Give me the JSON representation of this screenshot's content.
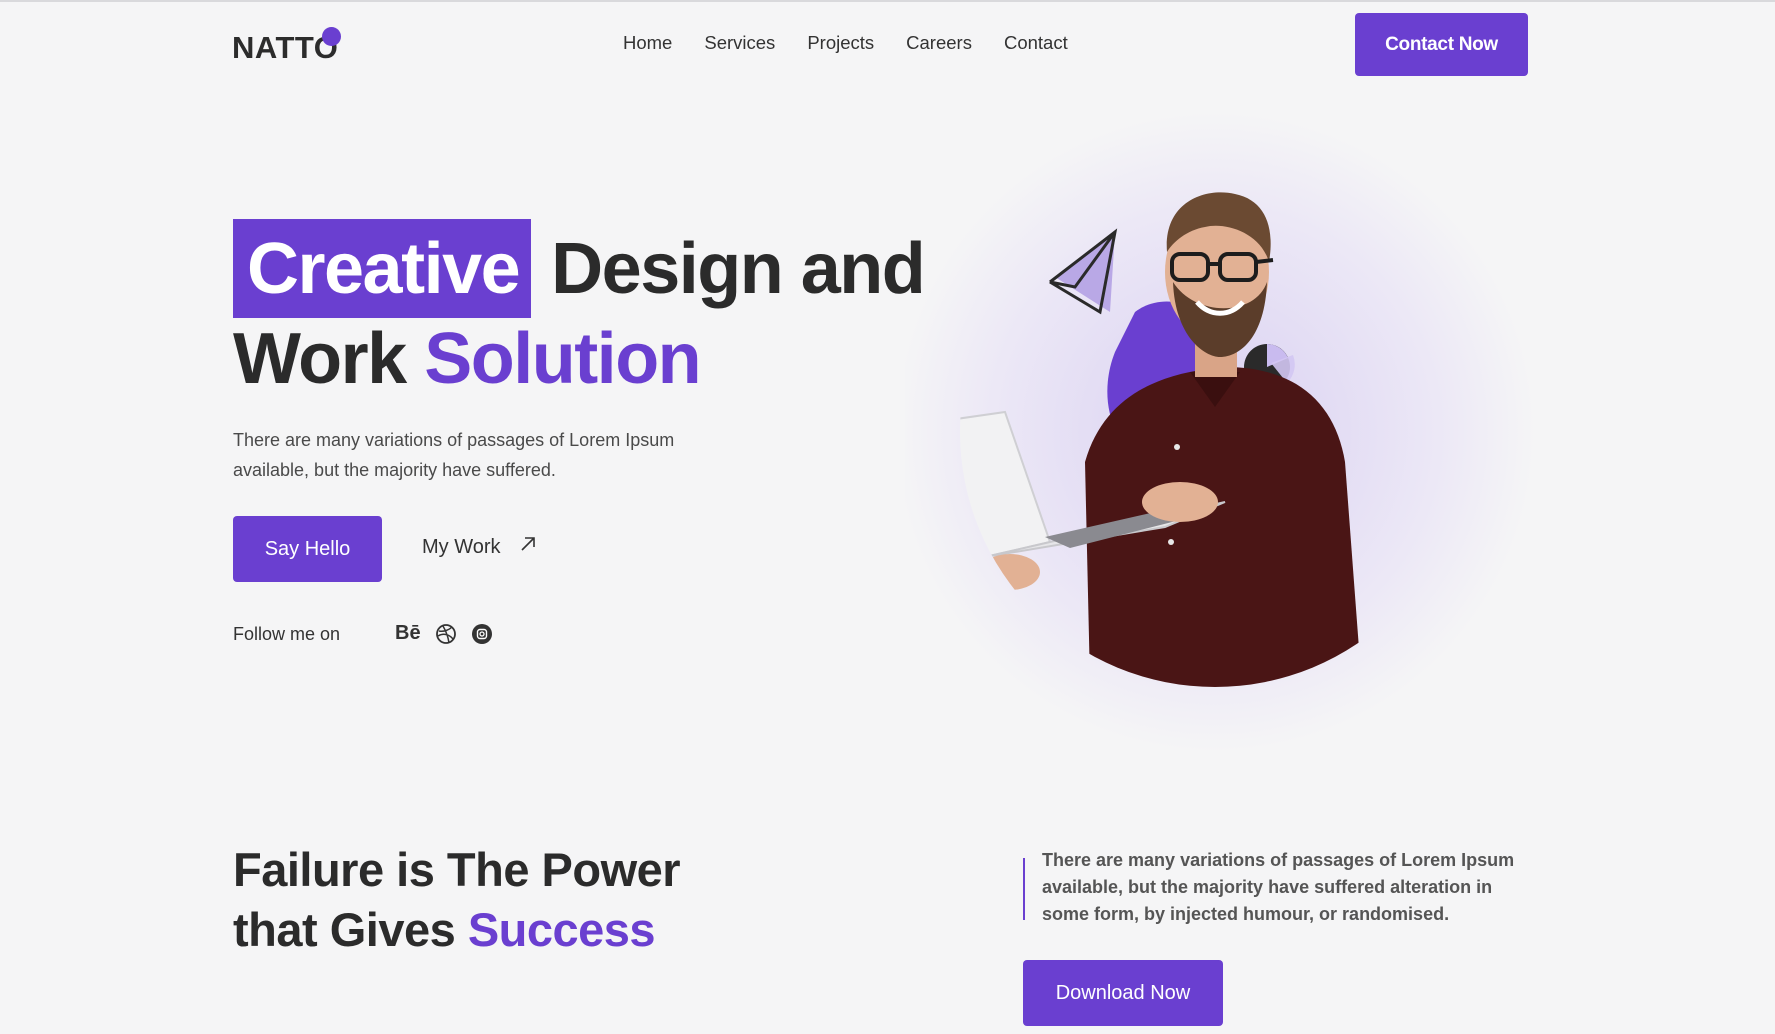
{
  "brand": {
    "logo": "NATTO",
    "accent_color": "#6a3fd0"
  },
  "nav": {
    "items": [
      {
        "label": "Home"
      },
      {
        "label": "Services"
      },
      {
        "label": "Projects"
      },
      {
        "label": "Careers"
      },
      {
        "label": "Contact"
      }
    ],
    "cta_label": "Contact Now"
  },
  "hero": {
    "highlight_word": "Creative",
    "line1_rest": "Design and",
    "line2_plain": "Work",
    "line2_accent": "Solution",
    "description": "There are many variations of passages of Lorem Ipsum available, but the majority have suffered.",
    "primary_button": "Say Hello",
    "secondary_link": "My Work",
    "follow_label": "Follow me on",
    "socials": [
      {
        "icon": "behance-icon",
        "label": "Bē"
      },
      {
        "icon": "dribbble-icon"
      },
      {
        "icon": "instagram-icon"
      }
    ]
  },
  "section2": {
    "title_line1": "Failure is The Power",
    "title_line2_plain": "that Gives",
    "title_line2_accent": "Success",
    "quote": "There are many variations of passages of Lorem Ipsum available, but the majority have suffered alteration in some form, by injected humour, or randomised.",
    "button": "Download Now"
  }
}
